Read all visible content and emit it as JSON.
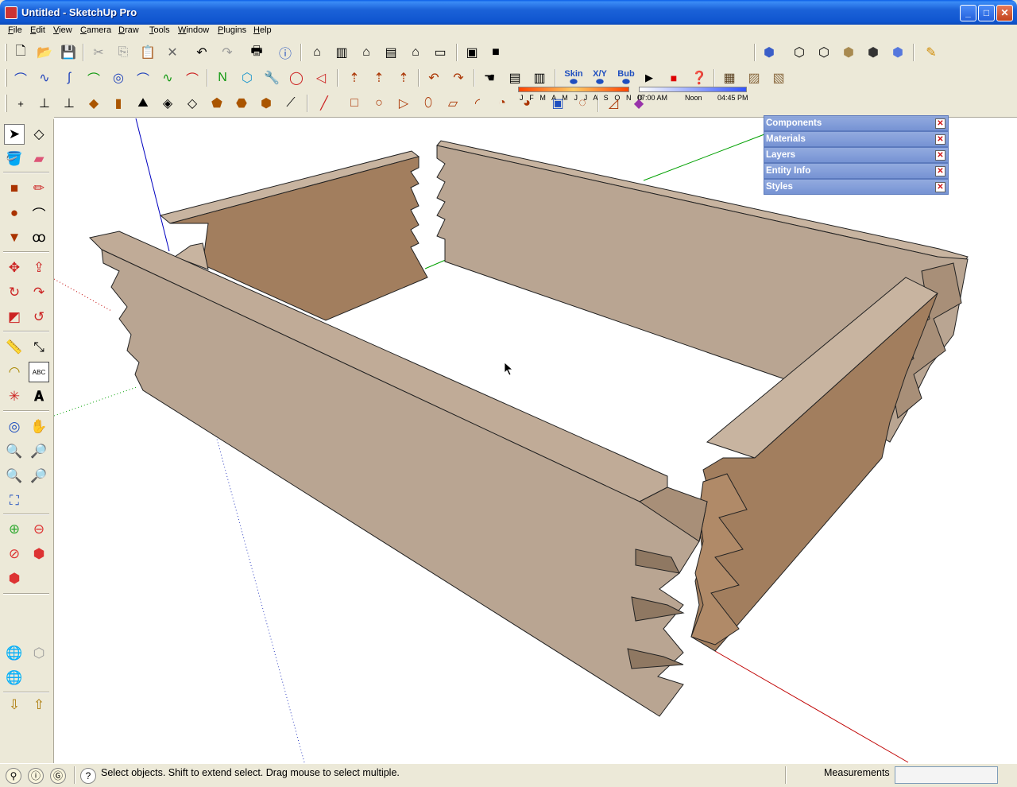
{
  "window": {
    "title": "Untitled - SketchUp Pro"
  },
  "menu": [
    "File",
    "Edit",
    "View",
    "Camera",
    "Draw",
    "Tools",
    "Window",
    "Plugins",
    "Help"
  ],
  "shadow_settings": {
    "months": "J F M A M J J A S O N D",
    "time_left": "07:00 AM",
    "time_mid": "Noon",
    "time_right": "04:45 PM"
  },
  "toolbar_labels": {
    "skin": "Skin",
    "xy": "X/Y",
    "bub": "Bub",
    "abc": "ABC"
  },
  "tray": {
    "panels": [
      "Components",
      "Materials",
      "Layers",
      "Entity Info",
      "Styles"
    ],
    "close_glyph": "✕"
  },
  "status": {
    "message": "Select objects. Shift to extend select. Drag mouse to select multiple.",
    "measurements_label": "Measurements",
    "measurements_value": ""
  },
  "colors": {
    "board_light": "#b9a592",
    "board_mid": "#a88f78",
    "board_dark": "#a27e5e",
    "board_top": "#c8b4a0",
    "axis_red": "#c00000",
    "axis_green": "#00a000",
    "axis_blue": "#0000c0"
  },
  "icons": {
    "window_buttons": [
      "minimize-icon",
      "maximize-icon",
      "close-icon"
    ],
    "status": [
      "geo-location-icon",
      "credits-icon",
      "user-icon",
      "help-icon"
    ]
  }
}
